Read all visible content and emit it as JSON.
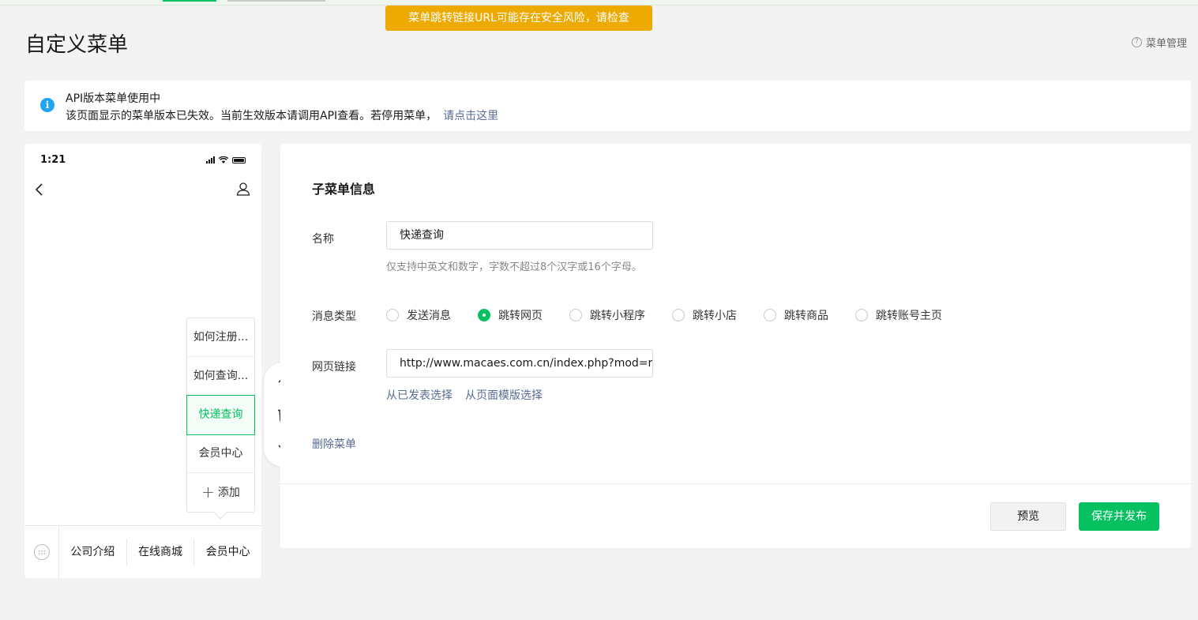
{
  "toast": {
    "text": "菜单跳转链接URL可能存在安全风险，请检查"
  },
  "header": {
    "title": "自定义菜单",
    "help_label": "菜单管理",
    "help_icon": "question-circle-icon"
  },
  "notice": {
    "icon": "info-icon",
    "title": "API版本菜单使用中",
    "desc": "该页面显示的菜单版本已失效。当前生效版本请调用API查看。若停用菜单，",
    "link": "请点击这里"
  },
  "phone": {
    "time": "1:21",
    "submenu": [
      {
        "label": "如何注册...",
        "active": false
      },
      {
        "label": "如何查询...",
        "active": false
      },
      {
        "label": "快递查询",
        "active": true
      },
      {
        "label": "会员中心",
        "active": false
      }
    ],
    "add_label": "添加",
    "menubar": [
      "公司介绍",
      "在线商城",
      "会员中心"
    ]
  },
  "form": {
    "section_title": "子菜单信息",
    "name_label": "名称",
    "name_value": "快递查询",
    "name_hint": "仅支持中英文和数字，字数不超过8个汉字或16个字母。",
    "type_label": "消息类型",
    "types": [
      {
        "label": "发送消息",
        "checked": false
      },
      {
        "label": "跳转网页",
        "checked": true
      },
      {
        "label": "跳转小程序",
        "checked": false
      },
      {
        "label": "跳转小店",
        "checked": false
      },
      {
        "label": "跳转商品",
        "checked": false
      },
      {
        "label": "跳转账号主页",
        "checked": false
      }
    ],
    "url_label": "网页链接",
    "url_value": "http://www.macaes.com.cn/index.php?mod=r",
    "select_published": "从已发表选择",
    "select_template": "从页面模版选择",
    "delete_label": "删除菜单"
  },
  "footer": {
    "preview_label": "预览",
    "publish_label": "保存并发布"
  },
  "colors": {
    "accent": "#07c160",
    "link": "#576b95",
    "toast": "#ecaa03",
    "info": "#1ea5f7"
  }
}
